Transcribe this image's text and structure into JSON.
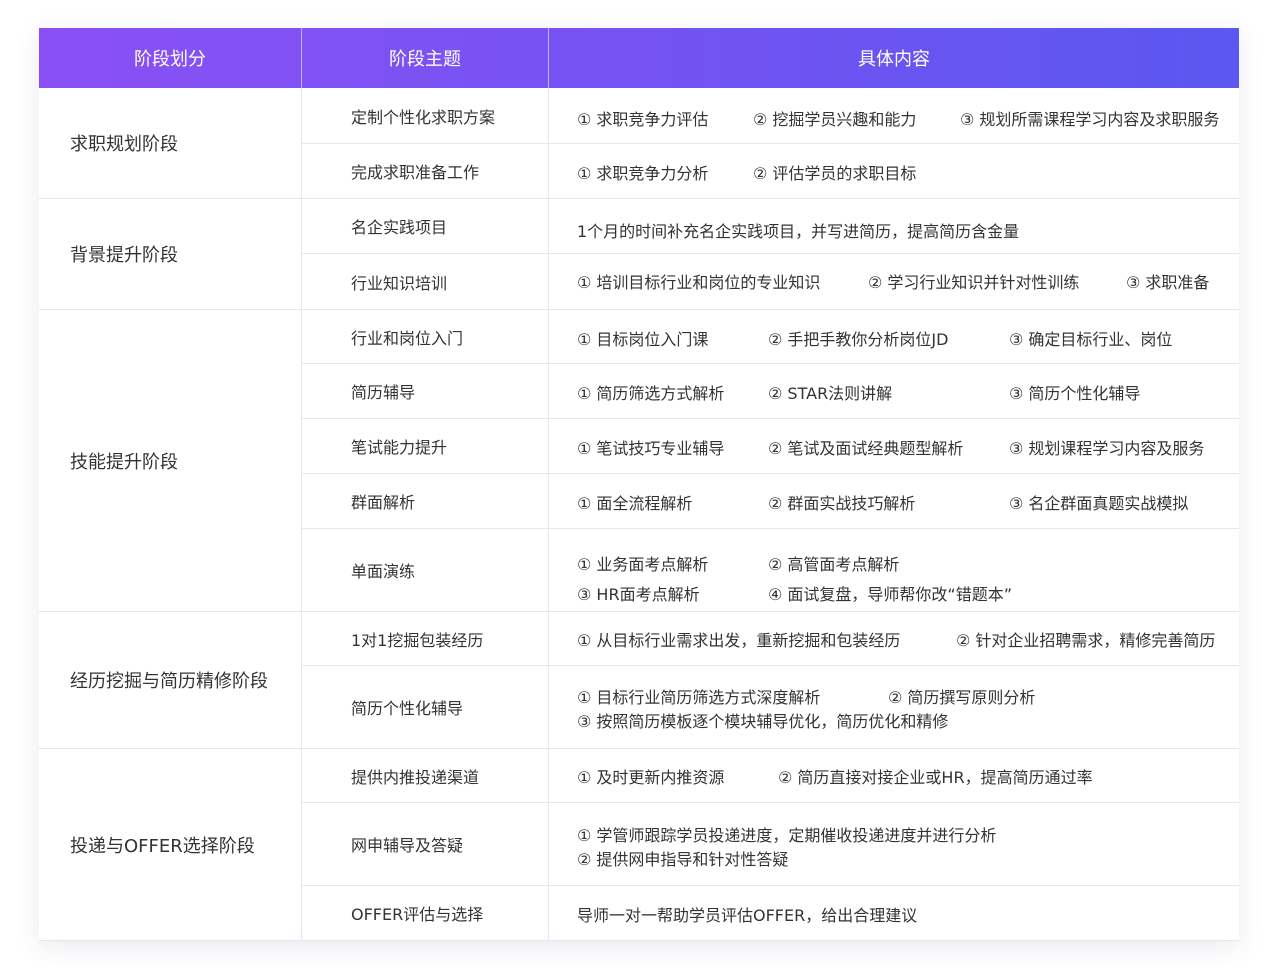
{
  "header": {
    "col1": "阶段划分",
    "col2": "阶段主题",
    "col3": "具体内容"
  },
  "groups": [
    {
      "stage": "求职规划阶段",
      "rows": [
        {
          "theme": "定制个性化求职方案",
          "items": [
            "① 求职竞争力评估",
            "② 挖掘学员兴趣和能力",
            "③ 规划所需课程学习内容及求职服务"
          ]
        },
        {
          "theme": "完成求职准备工作",
          "items": [
            "① 求职竞争力分析",
            "② 评估学员的求职目标"
          ]
        }
      ]
    },
    {
      "stage": "背景提升阶段",
      "rows": [
        {
          "theme": "名企实践项目",
          "items": [
            "1个月的时间补充名企实践项目，并写进简历，提高简历含金量"
          ]
        },
        {
          "theme": "行业知识培训",
          "items": [
            "① 培训目标行业和岗位的专业知识",
            "② 学习行业知识并针对性训练",
            "③ 求职准备"
          ]
        }
      ]
    },
    {
      "stage": "技能提升阶段",
      "rows": [
        {
          "theme": "行业和岗位入门",
          "items": [
            "① 目标岗位入门课",
            "② 手把手教你分析岗位JD",
            "③ 确定目标行业、岗位"
          ]
        },
        {
          "theme": "简历辅导",
          "items": [
            "① 简历筛选方式解析",
            "② STAR法则讲解",
            "③ 简历个性化辅导"
          ]
        },
        {
          "theme": "笔试能力提升",
          "items": [
            "① 笔试技巧专业辅导",
            "② 笔试及面试经典题型解析",
            "③ 规划课程学习内容及服务"
          ]
        },
        {
          "theme": "群面解析",
          "items": [
            "① 面全流程解析",
            "② 群面实战技巧解析",
            "③ 名企群面真题实战模拟"
          ]
        },
        {
          "theme": "单面演练",
          "items": [
            "① 业务面考点解析",
            "② 高管面考点解析",
            "③ HR面考点解析",
            "④ 面试复盘，导师帮你改“错题本”"
          ]
        }
      ]
    },
    {
      "stage": "经历挖掘与简历精修阶段",
      "rows": [
        {
          "theme": "1对1挖掘包装经历",
          "items": [
            "① 从目标行业需求出发，重新挖掘和包装经历",
            "② 针对企业招聘需求，精修完善简历"
          ]
        },
        {
          "theme": "简历个性化辅导",
          "items": [
            "① 目标行业简历筛选方式深度解析",
            "② 简历撰写原则分析",
            "③ 按照简历模板逐个模块辅导优化，简历优化和精修"
          ]
        }
      ]
    },
    {
      "stage": "投递与OFFER选择阶段",
      "rows": [
        {
          "theme": "提供内推投递渠道",
          "items": [
            "① 及时更新内推资源",
            "② 简历直接对接企业或HR，提高简历通过率"
          ]
        },
        {
          "theme": "网申辅导及答疑",
          "items": [
            "① 学管师跟踪学员投递进度，定期催收投递进度并进行分析",
            "② 提供网申指导和针对性答疑"
          ]
        },
        {
          "theme": "OFFER评估与选择",
          "items": [
            "导师一对一帮助学员评估OFFER，给出合理建议"
          ]
        }
      ]
    }
  ]
}
